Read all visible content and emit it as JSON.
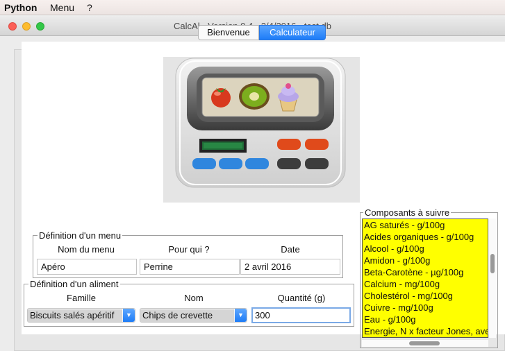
{
  "menubar": {
    "app": "Python",
    "menu": "Menu",
    "help": "?"
  },
  "window": {
    "title": "CalcAl - Version 0.4 - 2/4/2016 - test.db"
  },
  "tabs": [
    {
      "label": "Bienvenue",
      "active": false
    },
    {
      "label": "Calculateur",
      "active": true
    }
  ],
  "menu_def": {
    "legend": "Définition d'un menu",
    "headers": {
      "name": "Nom du menu",
      "who": "Pour qui ?",
      "date": "Date"
    },
    "values": {
      "name": "Apéro",
      "who": "Perrine",
      "date": "2 avril 2016"
    }
  },
  "food_def": {
    "legend": "Définition d'un aliment",
    "headers": {
      "family": "Famille",
      "name": "Nom",
      "quantity": "Quantité (g)"
    },
    "values": {
      "family": "Biscuits salés apéritif",
      "name": "Chips de crevette",
      "quantity": "300"
    }
  },
  "components": {
    "legend": "Composants à suivre",
    "items": [
      "AG saturés - g/100g",
      "Acides organiques - g/100g",
      "Alcool - g/100g",
      "Amidon - g/100g",
      "Beta-Carotène - µg/100g",
      "Calcium - mg/100g",
      "Cholestérol - mg/100g",
      "Cuivre - mg/100g",
      "Eau - g/100g",
      "Energie, N x facteur Jones, avec fibres"
    ]
  },
  "hero_icons": [
    "tomato-icon",
    "kiwi-icon",
    "cupcake-icon"
  ],
  "colors": {
    "accent": "#1d7cf7",
    "list_bg": "#ffff00"
  }
}
